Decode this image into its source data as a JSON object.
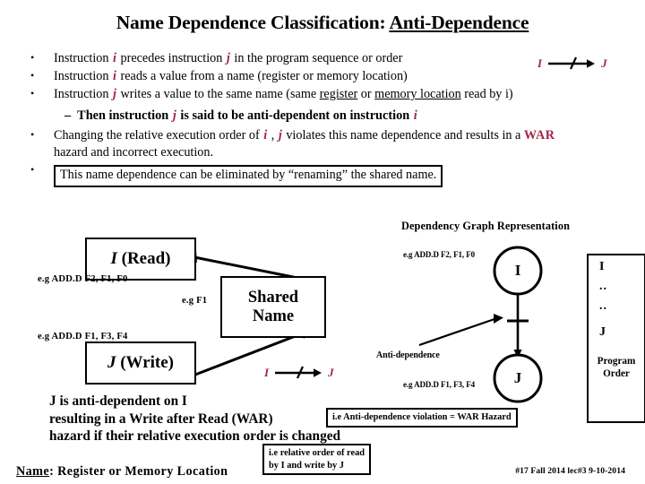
{
  "slide": {
    "title_main": "Name Dependence Classification:",
    "title_underlined": "Anti-Dependence",
    "accent_color": "#a32646"
  },
  "bullets": [
    {
      "marker": "•",
      "parts": [
        {
          "t": "Instruction ",
          "s": "plain"
        },
        {
          "t": "i",
          "s": "var"
        },
        {
          "t": " precedes instruction ",
          "s": "plain"
        },
        {
          "t": "j",
          "s": "var"
        },
        {
          "t": " in the program sequence or order",
          "s": "plain"
        }
      ]
    },
    {
      "marker": "•",
      "parts": [
        {
          "t": "Instruction ",
          "s": "plain"
        },
        {
          "t": "i",
          "s": "var"
        },
        {
          "t": " reads a value from a name (register or memory location)",
          "s": "plain"
        }
      ]
    },
    {
      "marker": "•",
      "parts": [
        {
          "t": "Instruction ",
          "s": "plain"
        },
        {
          "t": "j",
          "s": "var"
        },
        {
          "t": " writes a value to the same name (same ",
          "s": "plain"
        },
        {
          "t": "register",
          "s": "u"
        },
        {
          "t": " or ",
          "s": "plain"
        },
        {
          "t": "memory location",
          "s": "u"
        },
        {
          "t": " read by i)",
          "s": "plain"
        }
      ]
    }
  ],
  "sub_bullet": {
    "dash": "–",
    "parts": [
      {
        "t": "Then instruction ",
        "s": "plain"
      },
      {
        "t": "j",
        "s": "var"
      },
      {
        "t": " is said to be anti-dependent on instruction ",
        "s": "plain"
      },
      {
        "t": "i",
        "s": "var"
      }
    ]
  },
  "bullets_after": [
    {
      "marker": "•",
      "boxed": false,
      "parts": [
        {
          "t": "Changing the relative execution order of ",
          "s": "plain"
        },
        {
          "t": "i",
          "s": "var"
        },
        {
          "t": " , ",
          "s": "plain"
        },
        {
          "t": "j",
          "s": "var"
        },
        {
          "t": " violates this name dependence and results in a ",
          "s": "plain"
        },
        {
          "t": "WAR",
          "s": "war"
        },
        {
          "t": " hazard and incorrect execution.",
          "s": "plain"
        }
      ]
    },
    {
      "marker": "•",
      "boxed": true,
      "parts": [
        {
          "t": "This name dependence can be eliminated by “renaming” the shared name.",
          "s": "plain"
        }
      ]
    }
  ],
  "ij_arrow_header": {
    "left": "I",
    "right": "J"
  },
  "ij_arrow_diagram": {
    "left": "I",
    "right": "J"
  },
  "left_diagram": {
    "read_box": {
      "italic": "I",
      "rest": " (Read)"
    },
    "write_box": {
      "italic": "J",
      "rest": " (Write)"
    },
    "shared_box_line1": "Shared",
    "shared_box_line2": "Name",
    "eg_read": "e.g  ADD.D  F2, F1, F0",
    "eg_write": "e.g  ADD.D  F1, F3, F4",
    "eg_shared": "e.g F1"
  },
  "right_graph": {
    "heading": "Dependency Graph Representation",
    "node_i": "I",
    "node_j": "J",
    "eg_i": "e.g ADD.D  F2, F1, F0",
    "eg_j": "e.g ADD.D  F1, F3, F4",
    "edge_label": "Anti-dependence"
  },
  "program_order": {
    "first": "I",
    "dots1": "..",
    "dots2": "..",
    "last": "J",
    "caption_line1": "Program",
    "caption_line2": "Order"
  },
  "conclusion": {
    "line1": "J is anti-dependent on I",
    "line2": "resulting in a Write after Read (WAR)",
    "line3": "hazard if their relative execution order is changed"
  },
  "notes": {
    "war_hazard": "i.e Anti-dependence violation = WAR Hazard",
    "relative_order_line1": "i.e relative order of read",
    "relative_order_line2": "by I and write by J"
  },
  "name_definition": {
    "label": "Name",
    "rest": ":  Register   or   Memory Location"
  },
  "footer": "#17  Fall 2014 lec#3   9-10-2014"
}
